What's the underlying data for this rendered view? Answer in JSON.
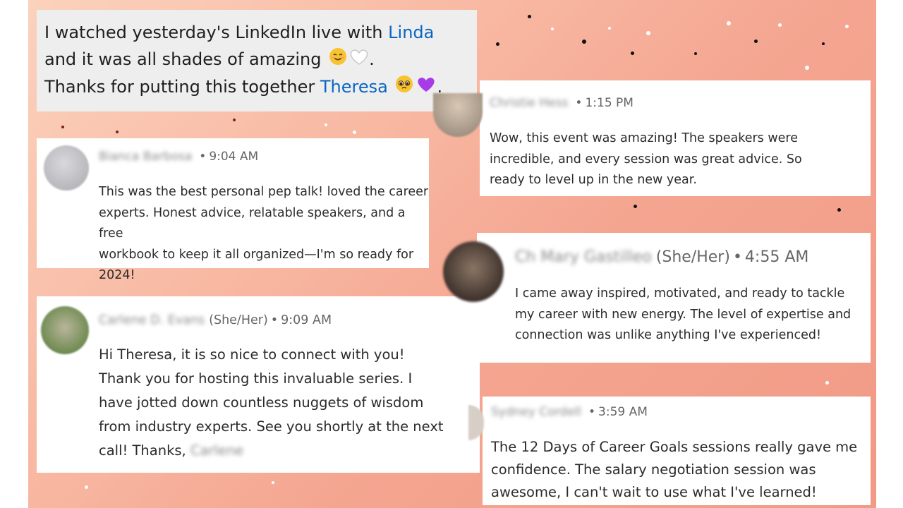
{
  "highlight": {
    "line1_prefix": "I watched yesterday's LinkedIn live with ",
    "line1_mention": "Linda",
    "line2_text": "and it was all shades of amazing ",
    "line2_suffix": ".",
    "line3_prefix": "Thanks for putting this together ",
    "line3_mention": "Theresa",
    "line3_suffix": ".",
    "emojis": [
      "smiling-face-icon",
      "white-heart-icon",
      "pleading-face-icon",
      "purple-heart-icon"
    ]
  },
  "comments": [
    {
      "name_blurred": "Bianca Barbosa",
      "pronouns": "",
      "time": "9:04 AM",
      "lines": [
        "This was the best personal pep talk! loved the career",
        "experts. Honest advice, relatable speakers, and a free",
        "workbook to keep it all organized—I'm so ready for",
        "2024!"
      ]
    },
    {
      "name_blurred": "Carlene D. Evans",
      "pronouns": "(She/Her)",
      "time": "9:09 AM",
      "lines": [
        "Hi Theresa, it is so nice to connect with you!",
        "Thank you for hosting this invaluable series. I",
        "have jotted down countless nuggets of wisdom",
        "from industry experts. See you shortly at the next",
        "call! Thanks, "
      ],
      "signoff_blurred": "Carlene"
    },
    {
      "name_blurred": "Christie Hess",
      "pronouns": "",
      "time": "1:15 PM",
      "lines": [
        "Wow, this event was amazing! The speakers were",
        "incredible, and every session was great advice. So",
        "ready to level up in the new year."
      ]
    },
    {
      "name_blurred": "Ch Mary Gastilleo",
      "pronouns": "(She/Her)",
      "time": "4:55 AM",
      "lines": [
        "I came away inspired, motivated, and ready to tackle",
        "my career with new energy. The level of expertise and",
        "connection was unlike anything I've experienced!"
      ]
    },
    {
      "name_blurred": "Sydney Cordell",
      "pronouns": "",
      "time": "3:59 AM",
      "lines": [
        "The 12 Days of Career Goals sessions really gave me",
        "confidence. The salary negotiation session was",
        "awesome, I can't wait to use what I've learned!"
      ]
    }
  ],
  "meta_separator": "•",
  "colors": {
    "mention": "#0a66c2",
    "background_start": "#fbd2bd",
    "background_end": "#f19a86",
    "card": "#ffffff",
    "highlight_card": "#eeeeee"
  }
}
